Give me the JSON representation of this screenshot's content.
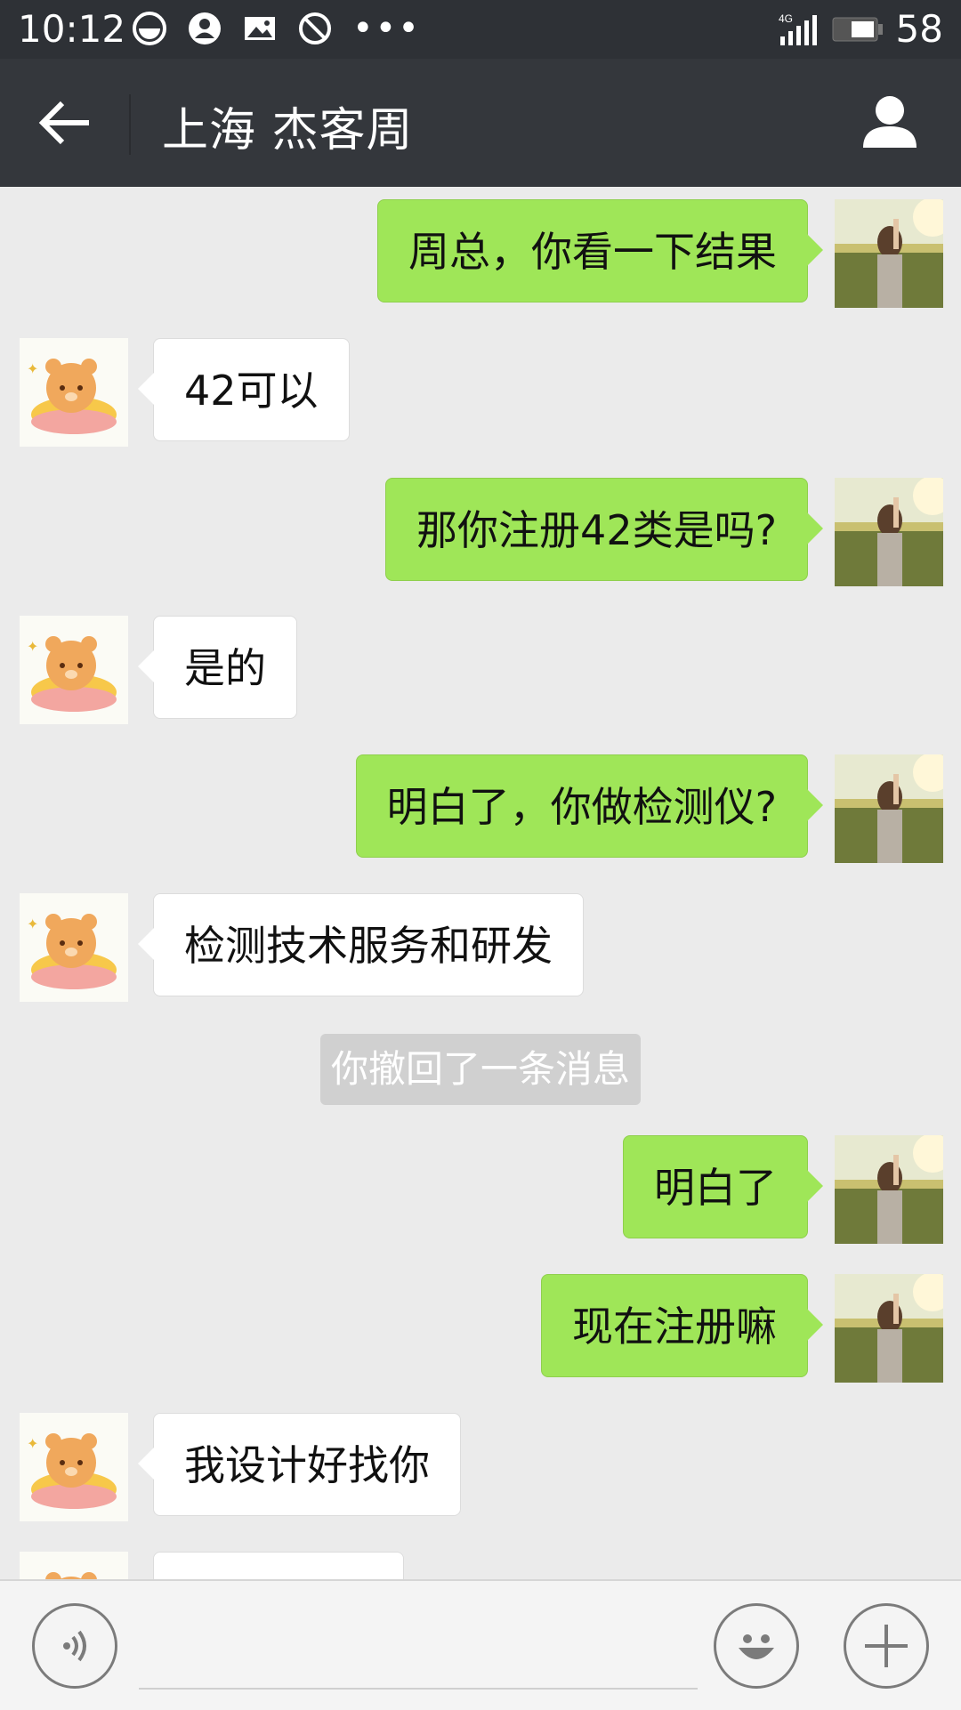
{
  "status_bar": {
    "time": "10:12",
    "network": "4G",
    "battery": "58"
  },
  "header": {
    "title": "上海 杰客周"
  },
  "messages": [
    {
      "sender": "self",
      "text": "周总，你看一下结果"
    },
    {
      "sender": "other",
      "text": "42可以"
    },
    {
      "sender": "self",
      "text": "那你注册42类是吗?"
    },
    {
      "sender": "other",
      "text": "是的"
    },
    {
      "sender": "self",
      "text": "明白了，你做检测仪?"
    },
    {
      "sender": "other",
      "text": "检测技术服务和研发"
    },
    {
      "sender": "system",
      "text": "你撤回了一条消息"
    },
    {
      "sender": "self",
      "text": "明白了"
    },
    {
      "sender": "self",
      "text": "现在注册嘛"
    },
    {
      "sender": "other",
      "text": "我设计好找你"
    }
  ],
  "input": {
    "placeholder": ""
  },
  "colors": {
    "self_bubble": "#9fe658",
    "other_bubble": "#ffffff",
    "header_bg": "#34373c"
  }
}
